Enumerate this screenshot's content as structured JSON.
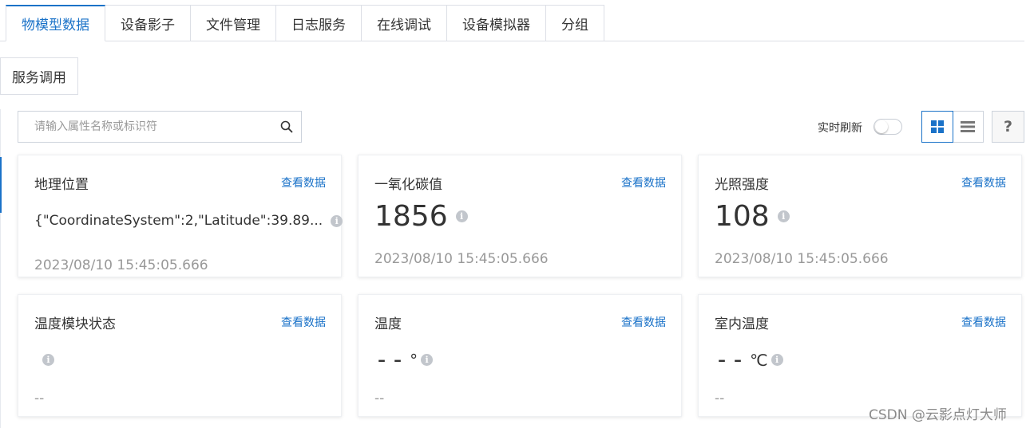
{
  "tabs": [
    {
      "label": "物模型数据",
      "active": true
    },
    {
      "label": "设备影子"
    },
    {
      "label": "文件管理"
    },
    {
      "label": "日志服务"
    },
    {
      "label": "在线调试"
    },
    {
      "label": "设备模拟器"
    },
    {
      "label": "分组"
    }
  ],
  "subtab": {
    "label": "服务调用"
  },
  "search": {
    "placeholder": "请输入属性名称或标识符",
    "icon": "search-icon"
  },
  "realtime": {
    "label": "实时刷新",
    "enabled": false
  },
  "view": {
    "grid_icon": "grid-view-icon",
    "list_icon": "list-view-icon",
    "active": "grid"
  },
  "help": {
    "label": "?"
  },
  "cards": [
    {
      "title": "地理位置",
      "link": "查看数据",
      "value": "{\"CoordinateSystem\":2,\"Latitude\":39.89...",
      "unit": "",
      "time": "2023/08/10 15:45:05.666"
    },
    {
      "title": "一氧化碳值",
      "link": "查看数据",
      "value": "1856",
      "unit": "",
      "time": "2023/08/10 15:45:05.666"
    },
    {
      "title": "光照强度",
      "link": "查看数据",
      "value": "108",
      "unit": "",
      "time": "2023/08/10 15:45:05.666"
    },
    {
      "title": "温度模块状态",
      "link": "查看数据",
      "value": "",
      "unit": "",
      "time": "--"
    },
    {
      "title": "温度",
      "link": "查看数据",
      "value": "--",
      "unit": "°",
      "time": "--"
    },
    {
      "title": "室内温度",
      "link": "查看数据",
      "value": "--",
      "unit": "℃",
      "time": "--"
    }
  ],
  "info_icon": {
    "glyph": "i",
    "name": "info-icon"
  },
  "colors": {
    "accent": "#1a72c8",
    "border": "#dcdfe6",
    "muted": "#999999"
  },
  "watermark": "CSDN @云影点灯大师"
}
